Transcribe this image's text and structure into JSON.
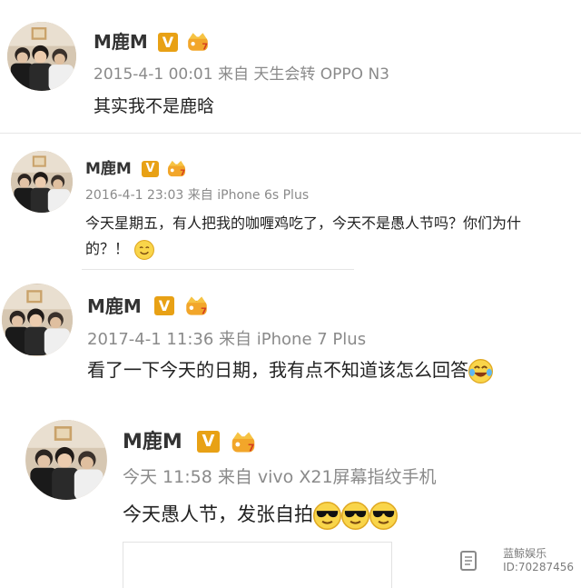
{
  "posts": [
    {
      "username": "M鹿M",
      "vip_badge": "V",
      "time": "2015-4-1 00:01",
      "source_prefix": "来自",
      "source": "天生会转 OPPO N3",
      "text": "其实我不是鹿晗"
    },
    {
      "username": "M鹿M",
      "vip_badge": "V",
      "time": "2016-4-1 23:03",
      "source_prefix": "来自",
      "source": "iPhone 6s Plus",
      "text_line1": "今天星期五，有人把我的咖喱鸡吃了，今天不是愚人节吗？你们为什",
      "text_line2": "的？！"
    },
    {
      "username": "M鹿M",
      "vip_badge": "V",
      "time": "2017-4-1 11:36",
      "source_prefix": "来自",
      "source": "iPhone 7 Plus",
      "text": "看了一下今天的日期，我有点不知道该怎么回答"
    },
    {
      "username": "M鹿M",
      "vip_badge": "V",
      "time": "今天 11:58",
      "source_prefix": "来自",
      "source": "vivo X21屏幕指纹手机",
      "text": "今天愚人节，发张自拍"
    }
  ],
  "watermark": {
    "brand": "蓝鲸娱乐",
    "id": "ID:70287456"
  },
  "icons": [
    "crown-badge-icon",
    "smile-emoji-icon",
    "laugh-cry-emoji-icon",
    "sunglasses-emoji-icon"
  ]
}
